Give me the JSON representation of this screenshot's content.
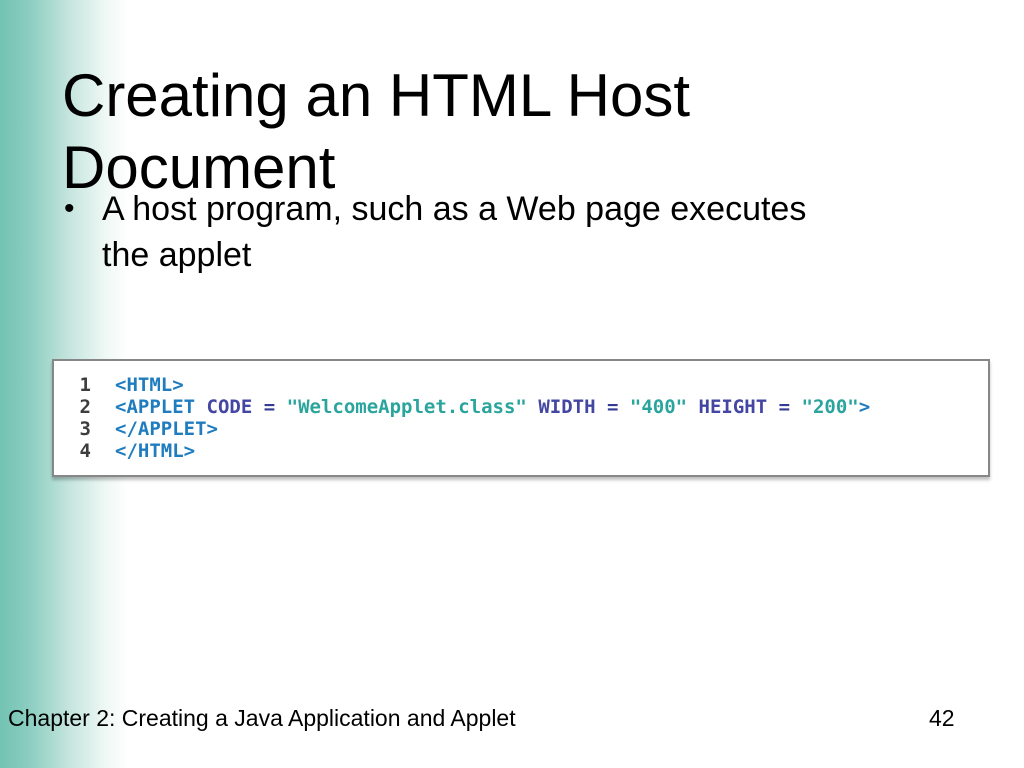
{
  "slide": {
    "title": "Creating an HTML Host Document",
    "bullets": [
      {
        "text": "A host program, such as a Web page executes the applet"
      }
    ],
    "bullet_marker": "•",
    "footer": {
      "left": "Chapter 2: Creating a Java Application and Applet",
      "page_number": "42"
    }
  },
  "code_box": {
    "lines": [
      {
        "number": "1",
        "segments": [
          {
            "text": "<HTML>",
            "color": "tag"
          }
        ]
      },
      {
        "number": "2",
        "segments": [
          {
            "text": "<APPLET ",
            "color": "tag"
          },
          {
            "text": "CODE",
            "color": "attr"
          },
          {
            "text": " ",
            "color": "attr"
          },
          {
            "text": "=",
            "color": "operator"
          },
          {
            "text": " ",
            "color": "attr"
          },
          {
            "text": "\"WelcomeApplet.class\"",
            "color": "string"
          },
          {
            "text": " ",
            "color": "attr"
          },
          {
            "text": "WIDTH",
            "color": "attr"
          },
          {
            "text": " ",
            "color": "attr"
          },
          {
            "text": "=",
            "color": "operator"
          },
          {
            "text": " ",
            "color": "attr"
          },
          {
            "text": "\"400\"",
            "color": "string"
          },
          {
            "text": " ",
            "color": "attr"
          },
          {
            "text": "HEIGHT",
            "color": "attr"
          },
          {
            "text": " ",
            "color": "attr"
          },
          {
            "text": "=",
            "color": "operator"
          },
          {
            "text": " ",
            "color": "attr"
          },
          {
            "text": "\"200\"",
            "color": "string"
          },
          {
            "text": ">",
            "color": "tag"
          }
        ]
      },
      {
        "number": "3",
        "segments": [
          {
            "text": "</APPLET>",
            "color": "tag"
          }
        ]
      },
      {
        "number": "4",
        "segments": [
          {
            "text": "</HTML>",
            "color": "tag"
          }
        ]
      }
    ]
  },
  "colors": {
    "tag": "#1f7cbf",
    "attr": "#4347a3",
    "operator": "#343b93",
    "string": "#2aa59d",
    "line_number": "#3d3d3d",
    "accent_teal": "#72c3b2",
    "box_border": "#878787"
  }
}
